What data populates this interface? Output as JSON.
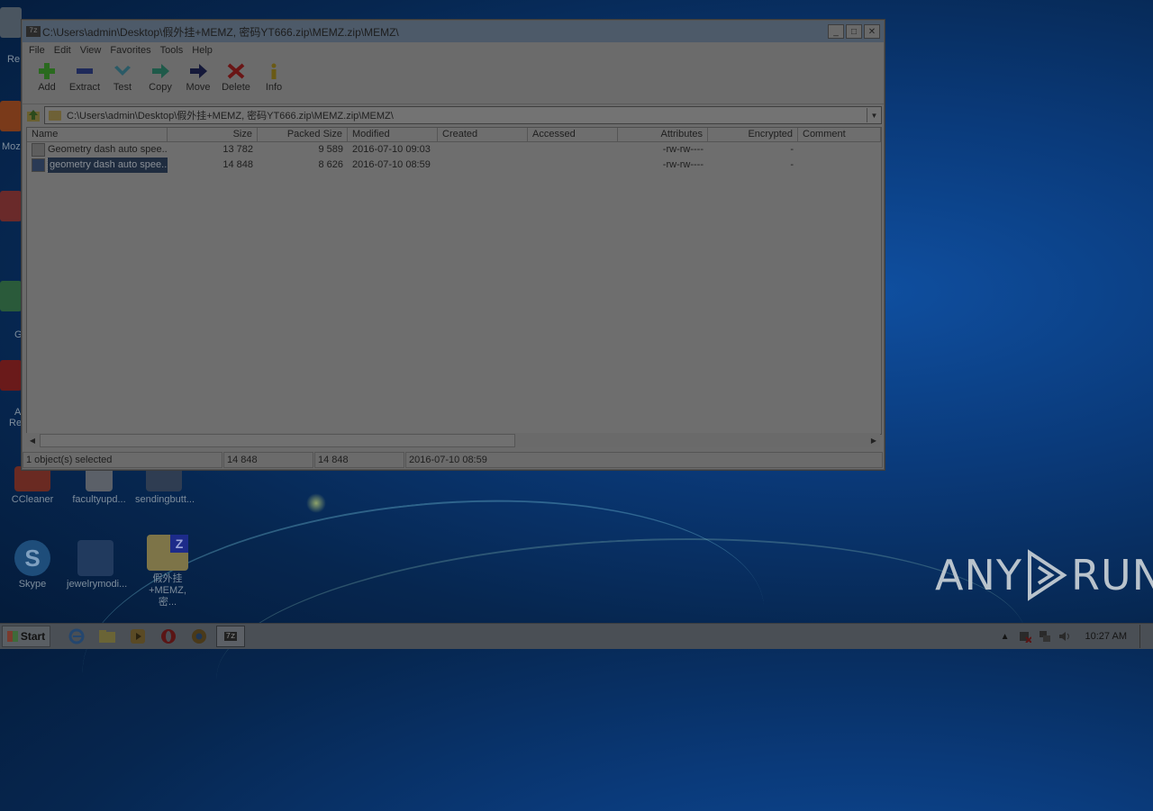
{
  "desktop": {
    "icons": [
      {
        "label": "CCleaner"
      },
      {
        "label": "facultyupd..."
      },
      {
        "label": "sendingbutt..."
      },
      {
        "label": "Skype"
      },
      {
        "label": "jewelrymodi..."
      },
      {
        "label": "假外挂+MEMZ, 密..."
      }
    ],
    "left_labels": [
      "Re",
      "Moz",
      "G",
      "A",
      "Re"
    ],
    "watermark_left": "ANY",
    "watermark_right": "RUN"
  },
  "window": {
    "title": "C:\\Users\\admin\\Desktop\\假外挂+MEMZ, 密码YT666.zip\\MEMZ.zip\\MEMZ\\",
    "app_icon_text": "7z",
    "controls": {
      "minimize": "_",
      "maximize": "□",
      "close": "✕"
    },
    "menu": [
      "File",
      "Edit",
      "View",
      "Favorites",
      "Tools",
      "Help"
    ],
    "toolbar": [
      {
        "label": "Add",
        "icon": "plus-icon",
        "color": "#2a6a1f"
      },
      {
        "label": "Extract",
        "icon": "minus-icon",
        "color": "#1f2a5a"
      },
      {
        "label": "Test",
        "icon": "check-icon",
        "color": "#2a5a66"
      },
      {
        "label": "Copy",
        "icon": "copy-arrow-icon",
        "color": "#1f5a4a"
      },
      {
        "label": "Move",
        "icon": "move-arrow-icon",
        "color": "#15193a"
      },
      {
        "label": "Delete",
        "icon": "delete-x-icon",
        "color": "#6a1515"
      },
      {
        "label": "Info",
        "icon": "info-icon",
        "color": "#6a5a15"
      }
    ],
    "address": "C:\\Users\\admin\\Desktop\\假外挂+MEMZ, 密码YT666.zip\\MEMZ.zip\\MEMZ\\",
    "columns": [
      "Name",
      "Size",
      "Packed Size",
      "Modified",
      "Created",
      "Accessed",
      "Attributes",
      "Encrypted",
      "Comment"
    ],
    "files": [
      {
        "name": "Geometry dash auto spee...",
        "size": "13 782",
        "packed": "9 589",
        "modified": "2016-07-10 09:03",
        "created": "",
        "accessed": "",
        "attributes": "-rw-rw----",
        "encrypted": "-",
        "comment": "",
        "selected": false
      },
      {
        "name": "geometry dash auto spee...",
        "size": "14 848",
        "packed": "8 626",
        "modified": "2016-07-10 08:59",
        "created": "",
        "accessed": "",
        "attributes": "-rw-rw----",
        "encrypted": "-",
        "comment": "",
        "selected": true
      }
    ],
    "status": {
      "selection": "1 object(s) selected",
      "size": "14 848",
      "packed": "14 848",
      "modified": "2016-07-10 08:59"
    }
  },
  "taskbar": {
    "start_label": "Start",
    "clock": "10:27 AM"
  }
}
